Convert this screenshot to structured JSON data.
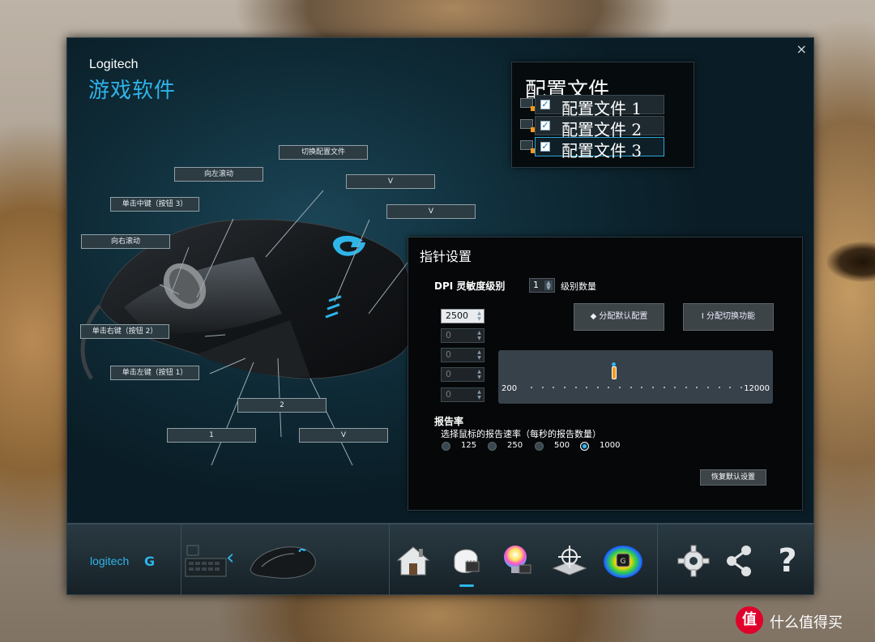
{
  "window": {
    "brand": "Logitech",
    "subtitle": "游戏软件",
    "close": "×"
  },
  "profiles": {
    "title": "配置文件",
    "items": [
      {
        "label": "配置文件 1",
        "checked": true
      },
      {
        "label": "配置文件 2",
        "checked": true
      },
      {
        "label": "配置文件 3",
        "checked": true,
        "active": true
      }
    ]
  },
  "mouse_buttons": {
    "switch_profile": "切换配置文件",
    "scroll_left": "向左滚动",
    "middle_click": "单击中键（按钮 3）",
    "scroll_right": "向右滚动",
    "right_click": "单击右键（按钮 2）",
    "left_click": "单击左键（按钮 1）",
    "g_top_1": "V",
    "g_top_2": "V",
    "g_bottom_1": "2",
    "g_bottom_2": "1",
    "g_bottom_3": "V"
  },
  "pointer": {
    "title": "指针设置",
    "dpi_label": "DPI 灵敏度级别",
    "level_count": "1",
    "level_count_label": "级别数量",
    "dpi_values": [
      "2500",
      "0",
      "0",
      "0",
      "0"
    ],
    "assign_default": "◆ 分配默认配置",
    "assign_shift": "I  分配切换功能",
    "slider_min": "200",
    "slider_max": "12000",
    "slider_value": 2500,
    "report_rate_title": "报告率",
    "report_rate_sub": "选择鼠标的报告速率（每秒的报告数量）",
    "rates": [
      "125",
      "250",
      "500",
      "1000"
    ],
    "selected_rate": "1000",
    "reset": "恢复默认设置"
  },
  "bottombar": {
    "logo": "logitech",
    "logo_mark": "G",
    "back_arrow": "‹",
    "icons": [
      "home-icon",
      "pointer-settings-icon",
      "lighting-icon",
      "surface-tuning-icon",
      "heatmap-icon",
      "settings-gear-icon",
      "share-icon",
      "help-icon"
    ],
    "help_glyph": "?"
  },
  "watermark": {
    "mark": "值",
    "text": "什么值得买"
  },
  "colors": {
    "accent": "#2eb5ea",
    "orange": "#f39a24"
  }
}
